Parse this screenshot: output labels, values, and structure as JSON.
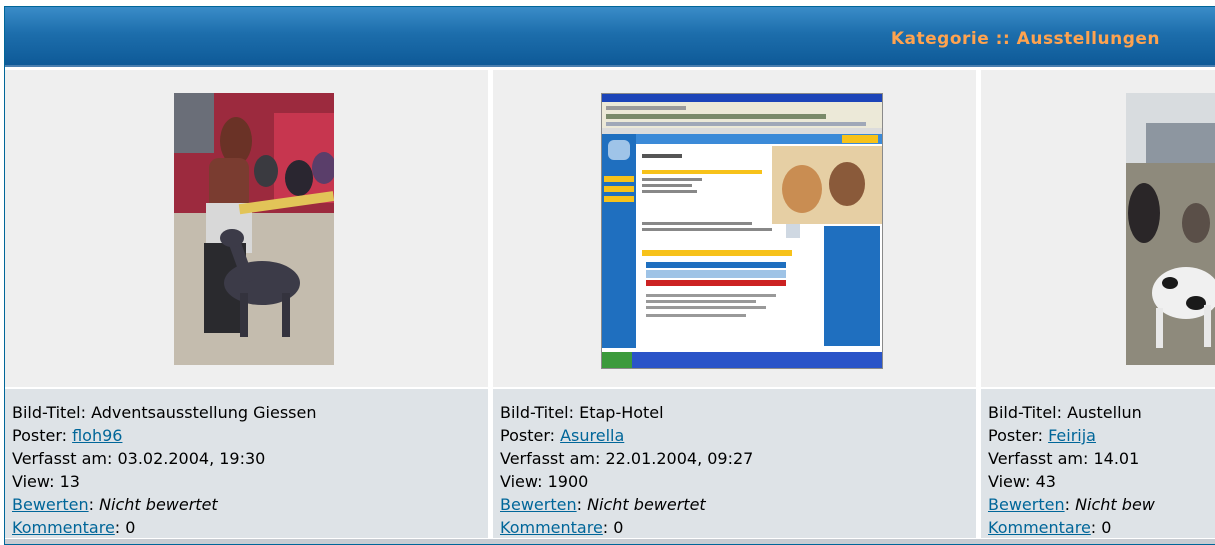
{
  "header": {
    "title": "Kategorie :: Ausstellungen"
  },
  "pictures": [
    {
      "title_label": "Bild-Titel: ",
      "title": "Adventsausstellung Giessen",
      "poster_label": "Poster: ",
      "poster": "floh96",
      "date_label": "Verfasst am: ",
      "date": "03.02.2004, 19:30",
      "view_label": "View: ",
      "views": "13",
      "rate_link": "Bewerten",
      "rate_sep": ": ",
      "rating": "Nicht bewertet",
      "comments_link": "Kommentare",
      "comments_sep": ": ",
      "comments": "0"
    },
    {
      "title_label": "Bild-Titel: ",
      "title": "Etap-Hotel",
      "poster_label": "Poster: ",
      "poster": "Asurella",
      "date_label": "Verfasst am: ",
      "date": "22.01.2004, 09:27",
      "view_label": "View: ",
      "views": "1900",
      "rate_link": "Bewerten",
      "rate_sep": ": ",
      "rating": "Nicht bewertet",
      "comments_link": "Kommentare",
      "comments_sep": ": ",
      "comments": "0"
    },
    {
      "title_label": "Bild-Titel: ",
      "title": "Austellun",
      "poster_label": "Poster: ",
      "poster": "Feirija",
      "date_label": "Verfasst am: ",
      "date": "14.01",
      "view_label": "View: ",
      "views": "43",
      "rate_link": "Bewerten",
      "rate_sep": ": ",
      "rating": "Nicht bew",
      "comments_link": "Kommentare",
      "comments_sep": ": ",
      "comments": "0"
    }
  ]
}
